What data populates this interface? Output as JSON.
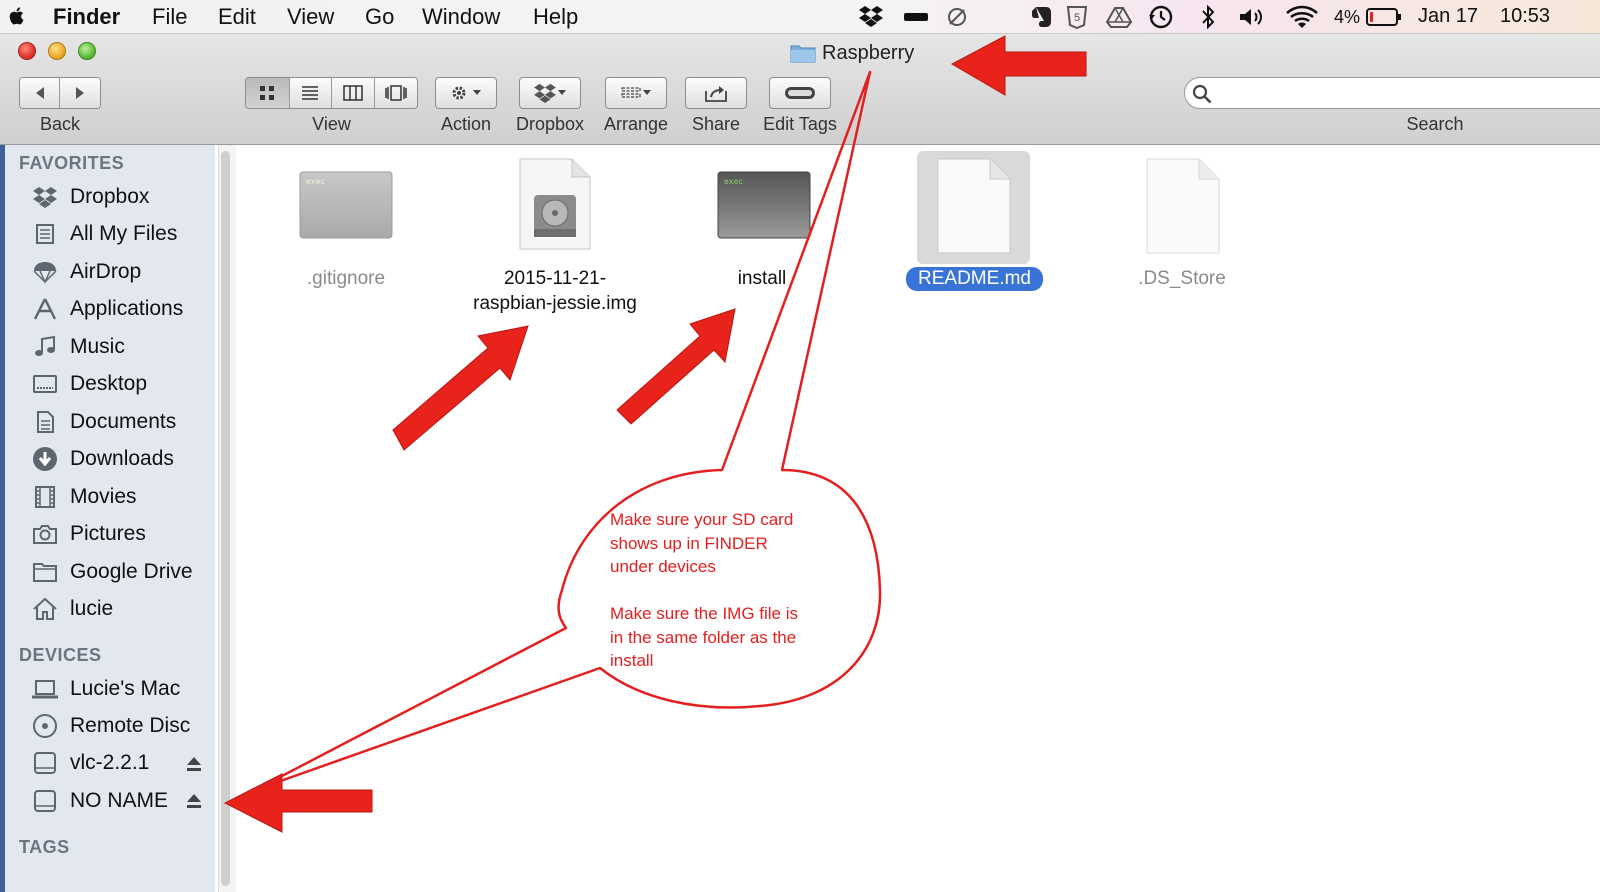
{
  "menubar": {
    "app": "Finder",
    "menus": [
      "File",
      "Edit",
      "View",
      "Go",
      "Window",
      "Help"
    ],
    "battery": "4%",
    "date": "Jan 17",
    "time": "10:53"
  },
  "window": {
    "title": "Raspberry"
  },
  "toolbar": {
    "back": "Back",
    "view": "View",
    "action": "Action",
    "dropbox": "Dropbox",
    "arrange": "Arrange",
    "share": "Share",
    "edit_tags": "Edit Tags",
    "search": "Search"
  },
  "sidebar": {
    "favorites_heading": "FAVORITES",
    "favorites": [
      "Dropbox",
      "All My Files",
      "AirDrop",
      "Applications",
      "Music",
      "Desktop",
      "Documents",
      "Downloads",
      "Movies",
      "Pictures",
      "Google Drive",
      "lucie"
    ],
    "devices_heading": "DEVICES",
    "devices": [
      "Lucie's Mac",
      "Remote Disc",
      "vlc-2.2.1",
      "NO NAME"
    ],
    "tags_heading": "TAGS"
  },
  "files": {
    "gitignore": ".gitignore",
    "img_line1": "2015-11-21-",
    "img_line2": "raspbian-jessie.img",
    "install": "install",
    "readme": "README.md",
    "ds_store": ".DS_Store",
    "exec_badge": "exec"
  },
  "annotation": {
    "line1": "Make sure your SD card",
    "line2": "shows up in FINDER",
    "line3": "under devices",
    "line4": "Make sure the IMG file is",
    "line5": "in the same folder as the",
    "line6": "install"
  },
  "colors": {
    "arrow": "#e8231c",
    "selection": "#3a73d6",
    "sidebar": "#e3e8ee"
  }
}
